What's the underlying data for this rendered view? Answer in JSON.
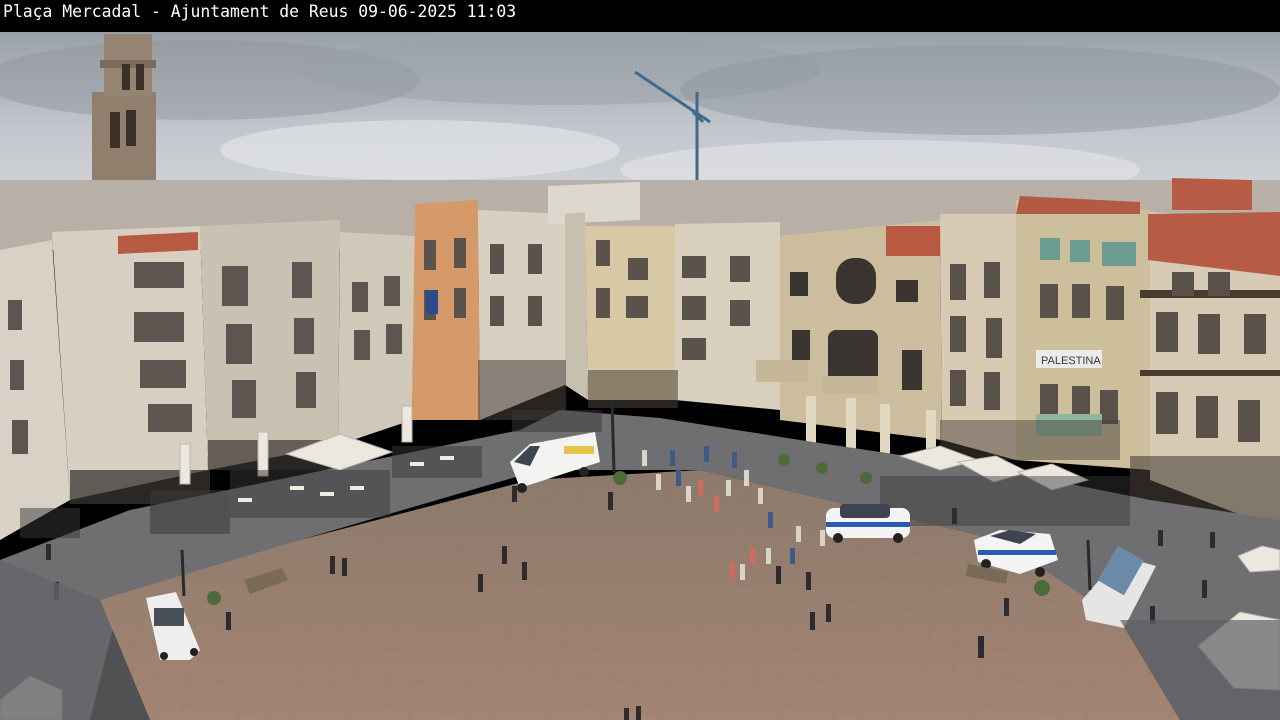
{
  "overlay": {
    "caption": "Plaça Mercadal - Ajuntament de Reus 09-06-2025 11:03"
  },
  "scene": {
    "description_icon": "webcam-view",
    "shop_signs": [
      "PALESTINA"
    ]
  }
}
